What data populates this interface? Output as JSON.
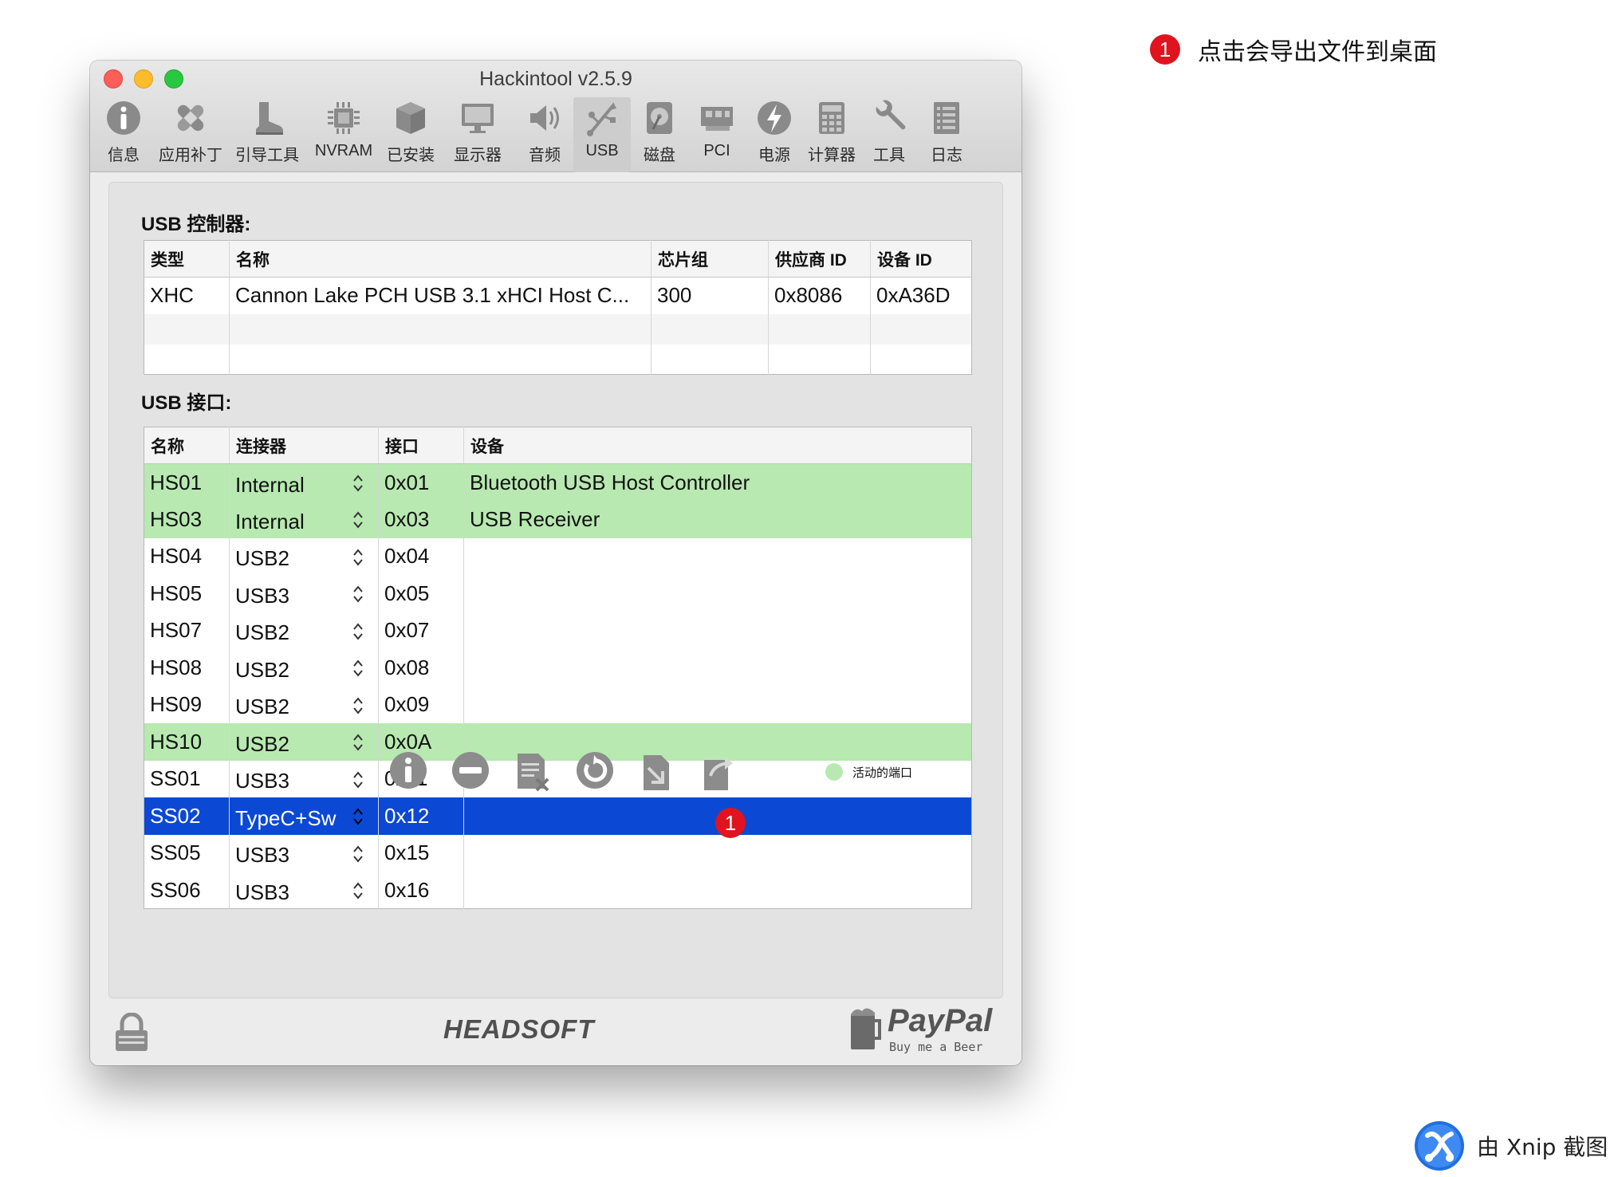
{
  "window": {
    "title": "Hackintool v2.5.9"
  },
  "toolbar": [
    {
      "label": "信息",
      "icon": "info-icon"
    },
    {
      "label": "应用补丁",
      "icon": "patch-bandage-icon"
    },
    {
      "label": "引导工具",
      "icon": "boot-icon"
    },
    {
      "label": "NVRAM",
      "icon": "chip-icon"
    },
    {
      "label": "已安装",
      "icon": "installed-box-icon"
    },
    {
      "label": "显示器",
      "icon": "display-icon"
    },
    {
      "label": "音频",
      "icon": "speaker-icon"
    },
    {
      "label": "USB",
      "icon": "usb-icon",
      "selected": true
    },
    {
      "label": "磁盘",
      "icon": "disk-icon"
    },
    {
      "label": "PCI",
      "icon": "pci-card-icon"
    },
    {
      "label": "电源",
      "icon": "power-bolt-icon"
    },
    {
      "label": "计算器",
      "icon": "calculator-icon"
    },
    {
      "label": "工具",
      "icon": "wrench-icon"
    },
    {
      "label": "日志",
      "icon": "log-icon"
    }
  ],
  "controllers": {
    "title": "USB 控制器:",
    "columns": [
      "类型",
      "名称",
      "芯片组",
      "供应商 ID",
      "设备 ID"
    ],
    "rows": [
      [
        "XHC",
        "Cannon Lake PCH USB 3.1 xHCI Host C...",
        "300",
        "0x8086",
        "0xA36D"
      ],
      [
        "",
        "",
        "",
        "",
        ""
      ],
      [
        "",
        "",
        "",
        "",
        ""
      ]
    ]
  },
  "ports": {
    "title": "USB 接口:",
    "columns": [
      "名称",
      "连接器",
      "接口",
      "设备"
    ],
    "rows": [
      {
        "name": "HS01",
        "connector": "Internal",
        "port": "0x01",
        "device": "Bluetooth USB Host Controller",
        "state": "active"
      },
      {
        "name": "HS03",
        "connector": "Internal",
        "port": "0x03",
        "device": "USB Receiver",
        "state": "active"
      },
      {
        "name": "HS04",
        "connector": "USB2",
        "port": "0x04",
        "device": "",
        "state": ""
      },
      {
        "name": "HS05",
        "connector": "USB3",
        "port": "0x05",
        "device": "",
        "state": ""
      },
      {
        "name": "HS07",
        "connector": "USB2",
        "port": "0x07",
        "device": "",
        "state": ""
      },
      {
        "name": "HS08",
        "connector": "USB2",
        "port": "0x08",
        "device": "",
        "state": ""
      },
      {
        "name": "HS09",
        "connector": "USB2",
        "port": "0x09",
        "device": "",
        "state": ""
      },
      {
        "name": "HS10",
        "connector": "USB2",
        "port": "0x0A",
        "device": "",
        "state": "active"
      },
      {
        "name": "SS01",
        "connector": "USB3",
        "port": "0x11",
        "device": "",
        "state": ""
      },
      {
        "name": "SS02",
        "connector": "TypeC+Sw",
        "port": "0x12",
        "device": "",
        "state": "selected"
      },
      {
        "name": "SS05",
        "connector": "USB3",
        "port": "0x15",
        "device": "",
        "state": ""
      },
      {
        "name": "SS06",
        "connector": "USB3",
        "port": "0x16",
        "device": "",
        "state": ""
      }
    ]
  },
  "bottom_tools": [
    {
      "name": "info-button",
      "icon": "info-icon"
    },
    {
      "name": "remove-button",
      "icon": "minus-icon"
    },
    {
      "name": "clear-button",
      "icon": "clear-list-icon"
    },
    {
      "name": "refresh-button",
      "icon": "refresh-icon"
    },
    {
      "name": "import-button",
      "icon": "import-icon"
    },
    {
      "name": "export-button",
      "icon": "export-icon"
    }
  ],
  "legend": {
    "label": "活动的端口",
    "color": "#b8e9b1"
  },
  "colors": {
    "active_row": "#b8e9b1",
    "selected_row": "#0b49d4",
    "badge": "#e0141e"
  },
  "footer": {
    "brand": "HEADSOFT",
    "paypal": "PayPal",
    "paypal_sub": "Buy me a Beer"
  },
  "annotation": {
    "badge": "1",
    "text": "点击会导出文件到桌面"
  },
  "watermark": {
    "text": "由 Xnip 截图"
  }
}
